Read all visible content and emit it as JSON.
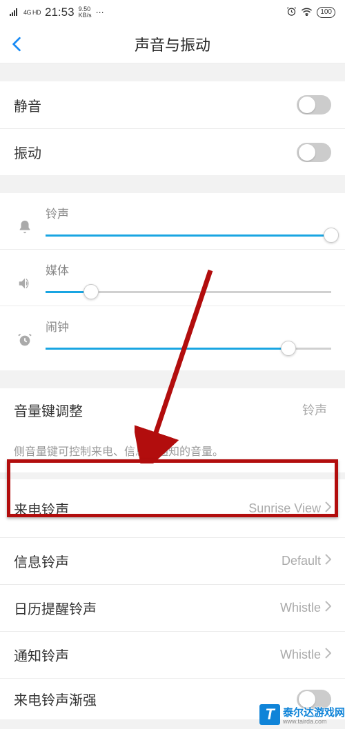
{
  "status": {
    "network_type": "4G HD",
    "time": "21:53",
    "net_speed_value": "9.50",
    "net_speed_unit": "KB/s",
    "more": "⋯",
    "alarm_icon": "alarm",
    "wifi_icon": "wifi",
    "battery_percent": "100"
  },
  "header": {
    "title": "声音与振动"
  },
  "toggles": {
    "mute_label": "静音",
    "mute_on": false,
    "vibrate_label": "振动",
    "vibrate_on": false
  },
  "volumes": {
    "ringtone": {
      "label": "铃声",
      "percent": 100
    },
    "media": {
      "label": "媒体",
      "percent": 16
    },
    "alarm": {
      "label": "闹钟",
      "percent": 85
    }
  },
  "volume_key": {
    "label": "音量键调整",
    "value": "铃声",
    "desc": "侧音量键可控制来电、信息和通知的音量。"
  },
  "ringtones": {
    "incoming": {
      "label": "来电铃声",
      "value": "Sunrise View"
    },
    "message": {
      "label": "信息铃声",
      "value": "Default"
    },
    "calendar": {
      "label": "日历提醒铃声",
      "value": "Whistle"
    },
    "notification": {
      "label": "通知铃声",
      "value": "Whistle"
    },
    "crescendo": {
      "label": "来电铃声渐强",
      "on": false
    }
  },
  "watermark": {
    "initial": "T",
    "name": "泰尔达游戏网",
    "url": "www.tairda.com"
  },
  "annotation": {
    "arrow_target": "来电铃声"
  },
  "colors": {
    "accent": "#19a5e2",
    "link": "#178af5",
    "highlight": "#b20d0d"
  }
}
